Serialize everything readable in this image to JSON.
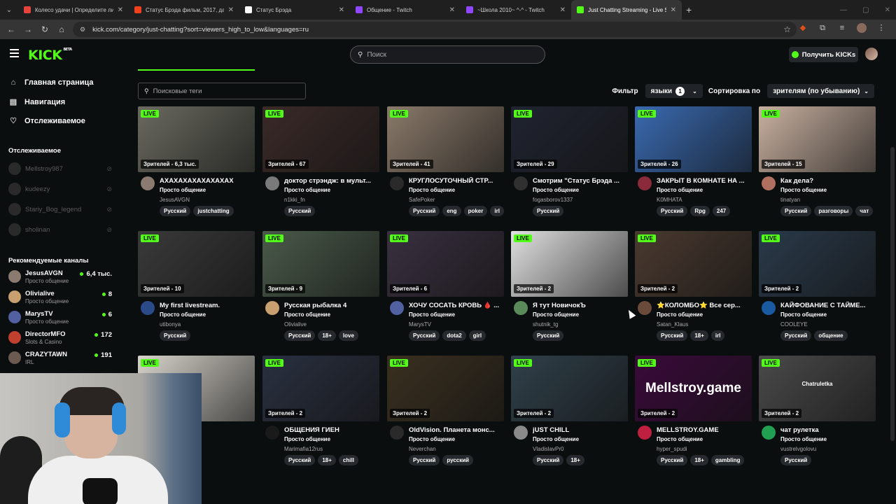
{
  "browser": {
    "tabs": [
      {
        "title": "Колесо удачи | Определите ли",
        "favicon_color": "#e4443b",
        "active": false
      },
      {
        "title": "Статус Брэда фильм, 2017, дат",
        "favicon_color": "#f0401c",
        "active": false
      },
      {
        "title": "Статус Брэда",
        "favicon_color": "#ffffff",
        "active": false
      },
      {
        "title": "Общение - Twitch",
        "favicon_color": "#9146ff",
        "active": false
      },
      {
        "title": "~Школа 2010~ ^-^ - Twitch",
        "favicon_color": "#9146ff",
        "active": false
      },
      {
        "title": "Just Chatting Streaming - Live S",
        "favicon_color": "#53fc18",
        "active": true
      }
    ],
    "url": "kick.com/category/just-chatting?sort=viewers_high_to_low&languages=ru",
    "new_tab": "+"
  },
  "header": {
    "logo": "KICK",
    "logo_badge": "BETA",
    "search_placeholder": "Поиск",
    "kicks_button": "Получить KICKs"
  },
  "sidebar": {
    "nav": [
      {
        "label": "Главная страница",
        "icon": "home-icon"
      },
      {
        "label": "Навигация",
        "icon": "compass-icon"
      },
      {
        "label": "Отслеживаемое",
        "icon": "heart-icon"
      }
    ],
    "following_title": "Отслеживаемое",
    "following": [
      "Mellstroy987",
      "kudeezy",
      "Stariy_Bog_legend",
      "sholinan"
    ],
    "recommended_title": "Рекомендуемые каналы",
    "recommended": [
      {
        "name": "JesusAVGN",
        "category": "Просто общение",
        "viewers": "6,4 тыс.",
        "avatar_color": "#8a7a70"
      },
      {
        "name": "Olivialive",
        "category": "Просто общение",
        "viewers": "8",
        "avatar_color": "#c8a070"
      },
      {
        "name": "MarysTV",
        "category": "Просто общение",
        "viewers": "6",
        "avatar_color": "#5060a0"
      },
      {
        "name": "DirectorMFO",
        "category": "Slots & Casino",
        "viewers": "172",
        "avatar_color": "#c04030"
      },
      {
        "name": "CRAZYTAWN",
        "category": "IRL",
        "viewers": "191",
        "avatar_color": "#6a5a50"
      }
    ]
  },
  "main": {
    "tag_search_placeholder": "Поисковые теги",
    "filter_label": "Фильтр",
    "languages_label": "языки",
    "languages_count": "1",
    "sort_label": "Сортировка по",
    "sort_value": "зрителям (по убыванию)",
    "live_label": "LIVE",
    "streams": [
      {
        "viewers": "Зрителей - 6,3 тыс.",
        "title": "АХАХАХАХАХАХАХАХ",
        "category": "Просто общение",
        "streamer": "JesusAVGN",
        "tags": [
          "Русский",
          "justchatting"
        ],
        "thumb": "#6a6a60",
        "avatar": "#8a7a70"
      },
      {
        "viewers": "Зрителей - 67",
        "title": "доктор стрэндж: в мульт...",
        "category": "Просто общение",
        "streamer": "n1kki_fn",
        "tags": [
          "Русский"
        ],
        "thumb": "#3a2a28",
        "avatar": "#7a7a7a"
      },
      {
        "viewers": "Зрителей - 41",
        "title": "КРУГЛОСУТОЧНЫЙ СТР...",
        "category": "Просто общение",
        "streamer": "SafePoker",
        "tags": [
          "Русский",
          "eng",
          "poker",
          "irl"
        ],
        "thumb": "#8a7a6a",
        "avatar": "#2a2a2a"
      },
      {
        "viewers": "Зрителей - 29",
        "title": "Смотрим \"Статус Брэда ...",
        "category": "Просто общение",
        "streamer": "fogasborov1337",
        "tags": [
          "Русский"
        ],
        "thumb": "#202430",
        "avatar": "#303030"
      },
      {
        "viewers": "Зрителей - 26",
        "title": "ЗАКРЫТ В КОМНАТЕ НА ...",
        "category": "Просто общение",
        "streamer": "K0MHATA",
        "tags": [
          "Русский",
          "Rpg",
          "247"
        ],
        "thumb": "#3a6ab0",
        "avatar": "#8a2a3a"
      },
      {
        "viewers": "Зрителей - 15",
        "title": "Как дела?",
        "category": "Просто общение",
        "streamer": "tinatyan",
        "tags": [
          "Русский",
          "разговоры",
          "чат"
        ],
        "thumb": "#c8b0a0",
        "avatar": "#b07060"
      },
      {
        "viewers": "Зрителей - 10",
        "title": "My first livestream.",
        "category": "Просто общение",
        "streamer": "utibonya",
        "tags": [
          "Русский"
        ],
        "thumb": "#3a3a3a",
        "avatar": "#2a4a8a"
      },
      {
        "viewers": "Зрителей - 9",
        "title": "Русская рыбалка 4",
        "category": "Просто общение",
        "streamer": "Olivialive",
        "tags": [
          "Русский",
          "18+",
          "love"
        ],
        "thumb": "#4a5a4a",
        "avatar": "#c8a070"
      },
      {
        "viewers": "Зрителей - 6",
        "title": "ХОЧУ СОСАТЬ КРОВЬ 🩸 ...",
        "category": "Просто общение",
        "streamer": "MarysTV",
        "tags": [
          "Русский",
          "dota2",
          "girl"
        ],
        "thumb": "#3a3040",
        "avatar": "#5060a0"
      },
      {
        "viewers": "Зрителей - 2",
        "title": "Я тут НовичокЪ",
        "category": "Просто общение",
        "streamer": "shutnik_tg",
        "tags": [
          "Русский"
        ],
        "thumb": "#e0e0e0",
        "avatar": "#5a8a5a"
      },
      {
        "viewers": "Зрителей - 2",
        "title": "⭐КОЛОМБО⭐ Все сер...",
        "category": "Просто общение",
        "streamer": "Satan_Klaus",
        "tags": [
          "Русский",
          "18+",
          "irl"
        ],
        "thumb": "#4a3a30",
        "avatar": "#6a4a3a"
      },
      {
        "viewers": "Зрителей - 2",
        "title": "КАЙФОВАНИЕ С ТАЙМЕ...",
        "category": "Просто общение",
        "streamer": "COOLEYE",
        "tags": [
          "Русский",
          "общение"
        ],
        "thumb": "#2a3a4a",
        "avatar": "#1a5aa0"
      },
      {
        "viewers": "",
        "title": "",
        "category": "",
        "streamer": "",
        "tags": [],
        "thumb": "#d8d4cc",
        "avatar": "#0b0e0f"
      },
      {
        "viewers": "Зрителей - 2",
        "title": "ОБЩЕНИЯ ГИЕН",
        "category": "Просто общение",
        "streamer": "Marimafia12rus",
        "tags": [
          "Русский",
          "18+",
          "chill"
        ],
        "thumb": "#2a3040",
        "avatar": "#1a1a1a"
      },
      {
        "viewers": "Зрителей - 2",
        "title": "OldVision. Планета монс...",
        "category": "Просто общение",
        "streamer": "Neverchan",
        "tags": [
          "Русский",
          "русский"
        ],
        "thumb": "#3a3020",
        "avatar": "#2a2a2a"
      },
      {
        "viewers": "Зрителей - 2",
        "title": "jUST CHILL",
        "category": "Просто общение",
        "streamer": "VladislavPr0",
        "tags": [
          "Русский",
          "18+"
        ],
        "thumb": "#30404a",
        "avatar": "#8a8a8a"
      },
      {
        "viewers": "Зрителей - 2",
        "title": "MELLSTROY.GAME",
        "category": "Просто общение",
        "streamer": "hyper_spudi",
        "tags": [
          "Русский",
          "18+",
          "gambling"
        ],
        "thumb": "#3a0a3a",
        "avatar": "#c02040",
        "overlay_text": "Mellstroy.game"
      },
      {
        "viewers": "Зрителей - 2",
        "title": "чат рулетка",
        "category": "Просто общение",
        "streamer": "vustrelvgolovu",
        "tags": [
          "Русский"
        ],
        "thumb": "#4a4a4a",
        "avatar": "#20a050",
        "overlay_text": "Chatruletka"
      }
    ]
  }
}
